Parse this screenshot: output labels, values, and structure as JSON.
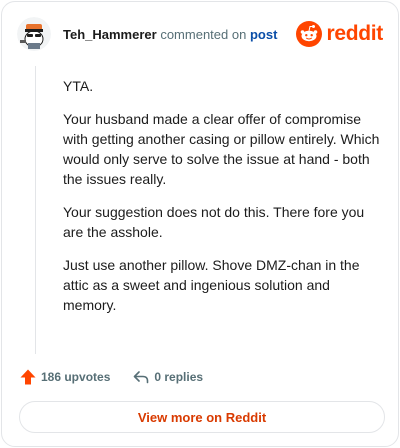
{
  "header": {
    "author": "Teh_Hammerer",
    "action_text": "commented on",
    "post_link_text": "post",
    "brand": "reddit"
  },
  "comment": {
    "paragraphs": [
      "YTA.",
      "Your husband made a clear offer of compromise with getting another casing or pillow entirely. Which would only serve to solve the issue at hand - both the issues really.",
      "Your suggestion does not do this. There fore you are the asshole.",
      "Just use another pillow. Shove DMZ-chan in the attic as a sweet and ingenious solution and memory."
    ]
  },
  "footer": {
    "upvotes": "186 upvotes",
    "replies": "0 replies"
  },
  "cta": {
    "label": "View more on Reddit"
  },
  "colors": {
    "brand": "#ff4500",
    "link": "#0a4ea8",
    "cta_text": "#d93a00",
    "muted": "#576f76"
  },
  "icons": [
    "avatar",
    "reddit-logo-icon",
    "upvote-arrow-icon",
    "reply-arrow-icon"
  ]
}
